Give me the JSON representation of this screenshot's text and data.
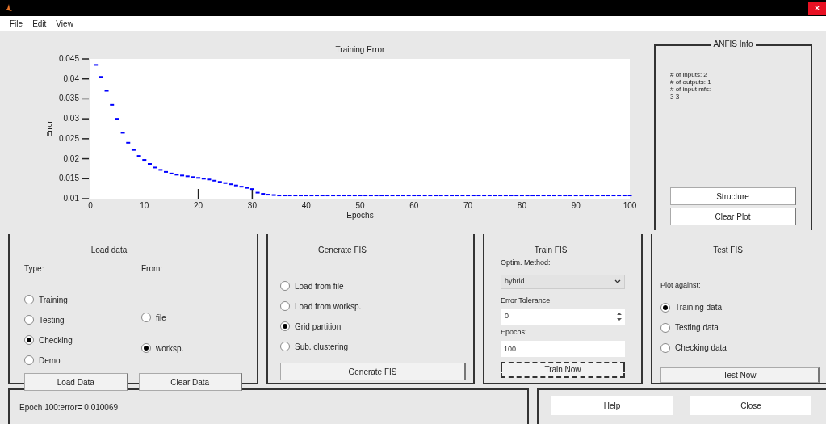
{
  "menu": [
    "File",
    "Edit",
    "View"
  ],
  "plot": {
    "chart_data": {
      "type": "scatter",
      "title": "Training Error",
      "xlabel": "Epochs",
      "ylabel": "Error",
      "xlim": [
        0,
        100
      ],
      "ylim": [
        0.01,
        0.045
      ],
      "xticks": [
        0,
        10,
        20,
        30,
        40,
        50,
        60,
        70,
        80,
        90,
        100
      ],
      "yticks": [
        0.01,
        0.015,
        0.02,
        0.025,
        0.03,
        0.035,
        0.04,
        0.045
      ],
      "series": [
        {
          "color": "#0000ff",
          "x": [
            1,
            2,
            3,
            4,
            5,
            6,
            7,
            8,
            9,
            10,
            11,
            12,
            13,
            14,
            15,
            16,
            17,
            18,
            19,
            20,
            21,
            22,
            23,
            24,
            25,
            26,
            27,
            28,
            29,
            30,
            31,
            32,
            33,
            34,
            35,
            36,
            37,
            38,
            39,
            40,
            41,
            42,
            43,
            44,
            45,
            46,
            47,
            48,
            49,
            50,
            51,
            52,
            53,
            54,
            55,
            56,
            57,
            58,
            59,
            60,
            61,
            62,
            63,
            64,
            65,
            66,
            67,
            68,
            69,
            70,
            71,
            72,
            73,
            74,
            75,
            76,
            77,
            78,
            79,
            80,
            81,
            82,
            83,
            84,
            85,
            86,
            87,
            88,
            89,
            90,
            91,
            92,
            93,
            94,
            95,
            96,
            97,
            98,
            99,
            100
          ],
          "values": [
            0.0435,
            0.0405,
            0.037,
            0.0335,
            0.03,
            0.0265,
            0.024,
            0.0222,
            0.0207,
            0.0197,
            0.0187,
            0.0178,
            0.0172,
            0.0167,
            0.0163,
            0.016,
            0.0158,
            0.0156,
            0.0154,
            0.0152,
            0.015,
            0.0148,
            0.0145,
            0.0142,
            0.0139,
            0.0136,
            0.0133,
            0.013,
            0.0127,
            0.0124,
            0.0115,
            0.0112,
            0.011,
            0.0109,
            0.0108,
            0.0108,
            0.0108,
            0.0108,
            0.0108,
            0.0108,
            0.0108,
            0.0108,
            0.0108,
            0.0108,
            0.0108,
            0.0108,
            0.0108,
            0.0108,
            0.0108,
            0.0108,
            0.0108,
            0.0108,
            0.0108,
            0.0108,
            0.0108,
            0.0108,
            0.0108,
            0.0108,
            0.0108,
            0.0108,
            0.0108,
            0.0108,
            0.0108,
            0.0108,
            0.0108,
            0.0108,
            0.0108,
            0.0108,
            0.0108,
            0.0108,
            0.0108,
            0.0108,
            0.0108,
            0.0108,
            0.0108,
            0.0108,
            0.0108,
            0.0108,
            0.0108,
            0.0108,
            0.0108,
            0.0108,
            0.0108,
            0.0108,
            0.0108,
            0.0108,
            0.0108,
            0.0108,
            0.0108,
            0.0108,
            0.0108,
            0.0108,
            0.0108,
            0.0108,
            0.0108,
            0.0108,
            0.0108,
            0.0108,
            0.0108,
            0.0108
          ]
        }
      ]
    }
  },
  "info": {
    "title": "ANFIS Info",
    "lines": [
      "# of inputs: 2",
      "# of outputs: 1",
      "# of input mfs:",
      "3 3"
    ],
    "buttons": [
      "Structure",
      "Clear Plot"
    ]
  },
  "load_data": {
    "title": "Load data",
    "type_label": "Type:",
    "from_label": "From:",
    "types": [
      {
        "label": "Training",
        "selected": false
      },
      {
        "label": "Testing",
        "selected": false
      },
      {
        "label": "Checking",
        "selected": true
      },
      {
        "label": "Demo",
        "selected": false
      }
    ],
    "sources": [
      {
        "label": "file",
        "selected": false
      },
      {
        "label": "worksp.",
        "selected": true
      }
    ],
    "buttons": [
      "Load Data",
      "Clear Data"
    ]
  },
  "generate_fis": {
    "title": "Generate FIS",
    "options": [
      {
        "label": "Load from file",
        "selected": false
      },
      {
        "label": "Load from worksp.",
        "selected": false
      },
      {
        "label": "Grid partition",
        "selected": true
      },
      {
        "label": "Sub. clustering",
        "selected": false
      }
    ],
    "button": "Generate FIS"
  },
  "train_fis": {
    "title": "Train FIS",
    "method_label": "Optim. Method:",
    "method": "hybrid",
    "tolerance_label": "Error Tolerance:",
    "tolerance": "0",
    "epochs_label": "Epochs:",
    "epochs": "100",
    "button": "Train Now"
  },
  "test_fis": {
    "title": "Test FIS",
    "plot_label": "Plot against:",
    "options": [
      {
        "label": "Training data",
        "selected": true
      },
      {
        "label": "Testing data",
        "selected": false
      },
      {
        "label": "Checking data",
        "selected": false
      }
    ],
    "button": "Test Now"
  },
  "status": "Epoch 100:error= 0.010069",
  "footer_buttons": [
    "Help",
    "Close"
  ]
}
